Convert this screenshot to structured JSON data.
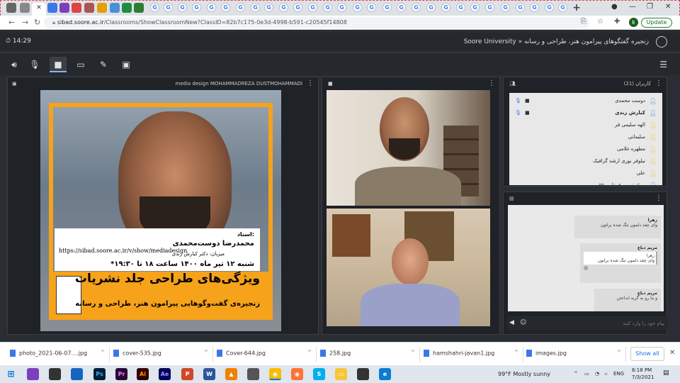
{
  "browser": {
    "url_domain": "sibad.soore.ac.ir",
    "url_path": "/Classrooms/ShowClassroomNew?ClassID=82b7c175-0e3d-4998-b591-c20545f14808",
    "update_label": "Update",
    "profile_initial": "k"
  },
  "app": {
    "clock": "14:29",
    "breadcrumb": "Soore University » زنجیره گفتگوهای پیرامون هنر، طراحی و رسانه"
  },
  "presentation": {
    "header": "media design MOHAMMADREZA DUSTMOHAMMADI",
    "poster": {
      "url": "https://sibad.soore.ac.ir/v/show/mediadesign",
      "ostad_label": "استاد:",
      "name": "محمدرضا دوست‌محمدی",
      "host": "میزبان: دکتر کیارش زندی",
      "date": "*شنبه ۱۲ تیر ماه ۱۴۰۰ ساعت ۱۸ تا ۱۹:۳۰",
      "title": "ویژگی‌های طراحی جلد نشریات",
      "subtitle": "زنجیره‌ی گفت‌وگوهایی پیرامون هنر، طراحی و رسانه"
    }
  },
  "users": {
    "header": "کاربران (21)",
    "list": [
      "دوست محمدی",
      "کیارش زندی",
      "الهه سلیمی فر",
      "سلیمانی",
      "مطهره غلامی",
      "نیلوفر نوری ارشد گرافیک",
      "علی",
      "زینب ...فرزا ... ۵۵/ ..."
    ]
  },
  "chat": {
    "messages": [
      {
        "who": "زهرا",
        "text": "وای چقد دلمون تنگ شده براتون"
      },
      {
        "who": "مریم دباغ",
        "quote_who": "زهرا",
        "quote": "وای چقد دلمون تنگ شده براتون",
        "text": "😢"
      },
      {
        "who": "مریم دباغ",
        "text": "و ما رو به گریه انداختن"
      }
    ],
    "placeholder": "پیام خود را وارد کنید"
  },
  "downloads": {
    "files": [
      "photo_2021-06-07....jpg",
      "cover-535.jpg",
      "Cover-644.jpg",
      "258.jpg",
      "hamshahri-javan1.jpg",
      "images.jpg"
    ],
    "show_all": "Show all"
  },
  "taskbar": {
    "weather": "99°F  Mostly sunny",
    "lang": "ENG",
    "time": "6:18 PM",
    "date": "7/3/2021"
  },
  "colors": {
    "poster_orange": "#f6a21a",
    "accent_blue": "#8ab4f8"
  }
}
